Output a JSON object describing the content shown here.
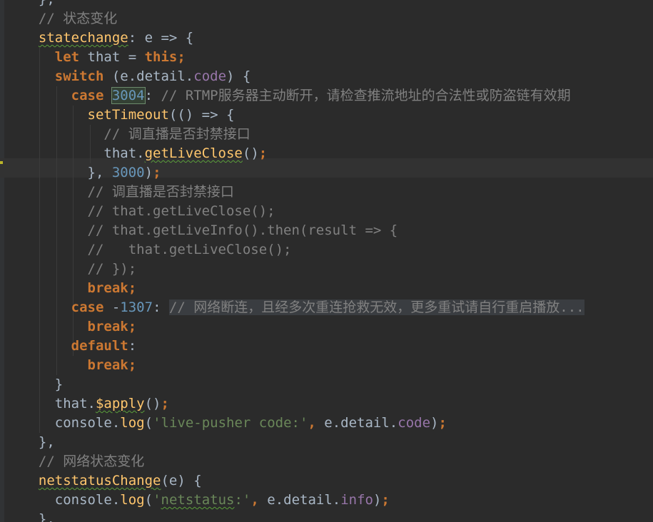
{
  "editor": {
    "language": "javascript",
    "theme": "darcula",
    "colors": {
      "background": "#2b2b2b",
      "keyword": "#cc7832",
      "comment": "#808080",
      "number": "#6897bb",
      "string": "#6a8759",
      "property": "#9876aa",
      "function": "#ffc66d",
      "text": "#a9b7c6"
    },
    "lines": [
      [
        [
          "plain",
          "  },"
        ]
      ],
      [
        [
          "cm",
          "  // 状态变化"
        ]
      ],
      [
        [
          "plain",
          "  "
        ],
        [
          "fn",
          "statechange",
          "squig"
        ],
        [
          "plain",
          ": e => {"
        ]
      ],
      [
        [
          "plain",
          "    "
        ],
        [
          "kw",
          "let"
        ],
        [
          "plain",
          " that = "
        ],
        [
          "kw",
          "this"
        ],
        [
          "kw",
          ";"
        ]
      ],
      [
        [
          "plain",
          "    "
        ],
        [
          "kw",
          "switch"
        ],
        [
          "plain",
          " (e.detail."
        ],
        [
          "prop",
          "code"
        ],
        [
          "plain",
          ") {"
        ]
      ],
      [
        [
          "plain",
          "      "
        ],
        [
          "kw",
          "case"
        ],
        [
          "plain",
          " "
        ],
        [
          "num",
          "3004",
          "hl-box"
        ],
        [
          "plain",
          ": "
        ],
        [
          "cm",
          "// RTMP服务器主动断开，请检查推流地址的合法性或防盗链有效期"
        ]
      ],
      [
        [
          "plain",
          "        "
        ],
        [
          "fn",
          "setTimeout"
        ],
        [
          "plain",
          "(() => {"
        ]
      ],
      [
        [
          "plain",
          "          "
        ],
        [
          "cm",
          "// 调直播是否封禁接口"
        ]
      ],
      [
        [
          "plain",
          "          that."
        ],
        [
          "fn",
          "getLiveClose",
          "squig"
        ],
        [
          "plain",
          "()"
        ],
        [
          "kw",
          ";"
        ]
      ],
      [
        [
          "plain",
          "        }, "
        ],
        [
          "num",
          "3000"
        ],
        [
          "plain",
          ")"
        ],
        [
          "kw",
          ";"
        ]
      ],
      [
        [
          "plain",
          "        "
        ],
        [
          "cm",
          "// 调直播是否封禁接口"
        ]
      ],
      [
        [
          "plain",
          "        "
        ],
        [
          "cm",
          "// that.getLiveClose();"
        ]
      ],
      [
        [
          "plain",
          "        "
        ],
        [
          "cm",
          "// that.getLiveInfo().then(result => {"
        ]
      ],
      [
        [
          "plain",
          "        "
        ],
        [
          "cm",
          "//   that.getLiveClose();"
        ]
      ],
      [
        [
          "plain",
          "        "
        ],
        [
          "cm",
          "// });"
        ]
      ],
      [
        [
          "plain",
          "        "
        ],
        [
          "kw",
          "break;"
        ]
      ],
      [
        [
          "plain",
          "      "
        ],
        [
          "kw",
          "case"
        ],
        [
          "plain",
          " -"
        ],
        [
          "num",
          "1307"
        ],
        [
          "plain",
          ": "
        ],
        [
          "cm",
          "// 网络断连，且经多次重连抢救无效，更多重试请自行重启播放...",
          "hl-sel"
        ]
      ],
      [
        [
          "plain",
          "        "
        ],
        [
          "kw",
          "break;"
        ]
      ],
      [
        [
          "plain",
          "      "
        ],
        [
          "kw",
          "default"
        ],
        [
          "plain",
          ":"
        ]
      ],
      [
        [
          "plain",
          "        "
        ],
        [
          "kw",
          "break;"
        ]
      ],
      [
        [
          "plain",
          "    }"
        ]
      ],
      [
        [
          "plain",
          "    that."
        ],
        [
          "fn",
          "$apply",
          "squig"
        ],
        [
          "plain",
          "()"
        ],
        [
          "kw",
          ";"
        ]
      ],
      [
        [
          "plain",
          "    console."
        ],
        [
          "fn",
          "log"
        ],
        [
          "plain",
          "("
        ],
        [
          "str",
          "'live-pusher code:'"
        ],
        [
          "kw",
          ","
        ],
        [
          "plain",
          " e.detail."
        ],
        [
          "prop",
          "code"
        ],
        [
          "plain",
          ")"
        ],
        [
          "kw",
          ";"
        ]
      ],
      [
        [
          "plain",
          "  },"
        ]
      ],
      [
        [
          "cm",
          "  // 网络状态变化"
        ]
      ],
      [
        [
          "plain",
          "  "
        ],
        [
          "fn",
          "netstatusChange",
          "squig"
        ],
        [
          "plain",
          "(e) {"
        ]
      ],
      [
        [
          "plain",
          "    console."
        ],
        [
          "fn",
          "log"
        ],
        [
          "plain",
          "("
        ],
        [
          "str",
          "'"
        ],
        [
          "str",
          "netstatus",
          "squig"
        ],
        [
          "str",
          ":'"
        ],
        [
          "kw",
          ","
        ],
        [
          "plain",
          " e.detail."
        ],
        [
          "prop",
          "info"
        ],
        [
          "plain",
          ")"
        ],
        [
          "kw",
          ";"
        ]
      ],
      [
        [
          "plain",
          "  },"
        ]
      ]
    ]
  }
}
